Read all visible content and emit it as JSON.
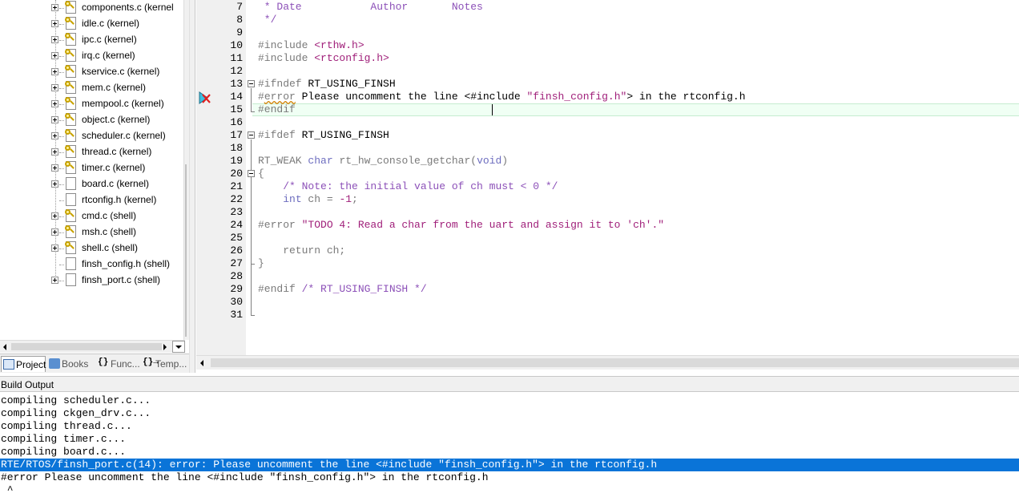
{
  "project_tree": {
    "items": [
      {
        "label": "components.c (kernel",
        "expandable": true,
        "key_icon": true
      },
      {
        "label": "idle.c (kernel)",
        "expandable": true,
        "key_icon": true
      },
      {
        "label": "ipc.c (kernel)",
        "expandable": true,
        "key_icon": true
      },
      {
        "label": "irq.c (kernel)",
        "expandable": true,
        "key_icon": true
      },
      {
        "label": "kservice.c (kernel)",
        "expandable": true,
        "key_icon": true
      },
      {
        "label": "mem.c (kernel)",
        "expandable": true,
        "key_icon": true
      },
      {
        "label": "mempool.c (kernel)",
        "expandable": true,
        "key_icon": true
      },
      {
        "label": "object.c (kernel)",
        "expandable": true,
        "key_icon": true
      },
      {
        "label": "scheduler.c (kernel)",
        "expandable": true,
        "key_icon": true
      },
      {
        "label": "thread.c (kernel)",
        "expandable": true,
        "key_icon": true
      },
      {
        "label": "timer.c (kernel)",
        "expandable": true,
        "key_icon": true
      },
      {
        "label": "board.c (kernel)",
        "expandable": true,
        "key_icon": false
      },
      {
        "label": "rtconfig.h (kernel)",
        "expandable": false,
        "key_icon": false
      },
      {
        "label": "cmd.c (shell)",
        "expandable": true,
        "key_icon": true
      },
      {
        "label": "msh.c (shell)",
        "expandable": true,
        "key_icon": true
      },
      {
        "label": "shell.c (shell)",
        "expandable": true,
        "key_icon": true
      },
      {
        "label": "finsh_config.h (shell)",
        "expandable": false,
        "key_icon": false
      },
      {
        "label": "finsh_port.c (shell)",
        "expandable": true,
        "key_icon": false
      }
    ]
  },
  "panel_tabs": {
    "project": "Project",
    "books": "Books",
    "functions": "Func...",
    "templates": "Temp...",
    "functions_icon": "{}",
    "templates_icon": "{}→"
  },
  "editor": {
    "lines": [
      {
        "no": "7",
        "segments": [
          {
            "t": " * Date           Author       Notes",
            "c": "cmt"
          }
        ]
      },
      {
        "no": "8",
        "segments": [
          {
            "t": " */",
            "c": "cmt"
          }
        ]
      },
      {
        "no": "9",
        "segments": []
      },
      {
        "no": "10",
        "segments": [
          {
            "t": "#include ",
            "c": "pre"
          },
          {
            "t": "<rthw.h>",
            "c": "str"
          }
        ]
      },
      {
        "no": "11",
        "segments": [
          {
            "t": "#include ",
            "c": "pre"
          },
          {
            "t": "<rtconfig.h>",
            "c": "str"
          }
        ]
      },
      {
        "no": "12",
        "segments": []
      },
      {
        "no": "13",
        "segments": [
          {
            "t": "#ifndef ",
            "c": "pre"
          },
          {
            "t": "RT_USING_FINSH",
            "c": "norm"
          }
        ]
      },
      {
        "no": "14",
        "segments": [
          {
            "t": "#",
            "c": "pre"
          },
          {
            "t": "error",
            "c": "pre-sq"
          },
          {
            "t": " Please uncomment the line <#include ",
            "c": "norm"
          },
          {
            "t": "\"finsh_config.h\"",
            "c": "str"
          },
          {
            "t": "> in the rtconfig.h",
            "c": "norm"
          }
        ]
      },
      {
        "no": "15",
        "segments": [
          {
            "t": "#endif",
            "c": "pre"
          }
        ]
      },
      {
        "no": "16",
        "segments": []
      },
      {
        "no": "17",
        "segments": [
          {
            "t": "#ifdef ",
            "c": "pre"
          },
          {
            "t": "RT_USING_FINSH",
            "c": "norm"
          }
        ]
      },
      {
        "no": "18",
        "segments": []
      },
      {
        "no": "19",
        "segments": [
          {
            "t": "RT_WEAK ",
            "c": "pre"
          },
          {
            "t": "char",
            "c": "type"
          },
          {
            "t": " rt_hw_console_getchar(",
            "c": "pre"
          },
          {
            "t": "void",
            "c": "type"
          },
          {
            "t": ")",
            "c": "pre"
          }
        ]
      },
      {
        "no": "20",
        "segments": [
          {
            "t": "{",
            "c": "pre"
          }
        ]
      },
      {
        "no": "21",
        "segments": [
          {
            "t": "    /* Note: the initial value of ch must < 0 */",
            "c": "cmt"
          }
        ]
      },
      {
        "no": "22",
        "segments": [
          {
            "t": "    ",
            "c": "norm"
          },
          {
            "t": "int",
            "c": "type"
          },
          {
            "t": " ch = ",
            "c": "pre"
          },
          {
            "t": "-1",
            "c": "str"
          },
          {
            "t": ";",
            "c": "pre"
          }
        ]
      },
      {
        "no": "23",
        "segments": []
      },
      {
        "no": "24",
        "segments": [
          {
            "t": "#error ",
            "c": "pre"
          },
          {
            "t": "\"TODO 4: Read a char from the uart and assign it to 'ch'.\"",
            "c": "str"
          }
        ]
      },
      {
        "no": "25",
        "segments": []
      },
      {
        "no": "26",
        "segments": [
          {
            "t": "    return ch;",
            "c": "pre"
          }
        ]
      },
      {
        "no": "27",
        "segments": [
          {
            "t": "}",
            "c": "pre"
          }
        ]
      },
      {
        "no": "28",
        "segments": []
      },
      {
        "no": "29",
        "segments": [
          {
            "t": "#endif ",
            "c": "pre"
          },
          {
            "t": "/* RT_USING_FINSH */",
            "c": "cmt"
          }
        ]
      },
      {
        "no": "30",
        "segments": []
      },
      {
        "no": "31",
        "segments": []
      }
    ]
  },
  "build_output": {
    "title": "Build Output",
    "lines": [
      {
        "text": "compiling scheduler.c...",
        "selected": false
      },
      {
        "text": "compiling ckgen_drv.c...",
        "selected": false
      },
      {
        "text": "compiling thread.c...",
        "selected": false
      },
      {
        "text": "compiling timer.c...",
        "selected": false
      },
      {
        "text": "compiling board.c...",
        "selected": false
      },
      {
        "text": "RTE/RTOS/finsh_port.c(14): error: Please uncomment the line <#include \"finsh_config.h\"> in the rtconfig.h",
        "selected": true
      },
      {
        "text": "#error Please uncomment the line <#include \"finsh_config.h\"> in the rtconfig.h",
        "selected": false
      },
      {
        "text": " ^",
        "selected": false
      }
    ]
  },
  "colors": {
    "selection": "#0a74d8",
    "preprocessor": "#7a7a7a",
    "string": "#a0207a",
    "comment": "#8c50b8",
    "type": "#6d6dbf",
    "error_marker": "#e02020"
  },
  "icons": {
    "tree_file": "file-icon",
    "tree_key": "key-icon",
    "error_marker": "error-cross-icon"
  }
}
